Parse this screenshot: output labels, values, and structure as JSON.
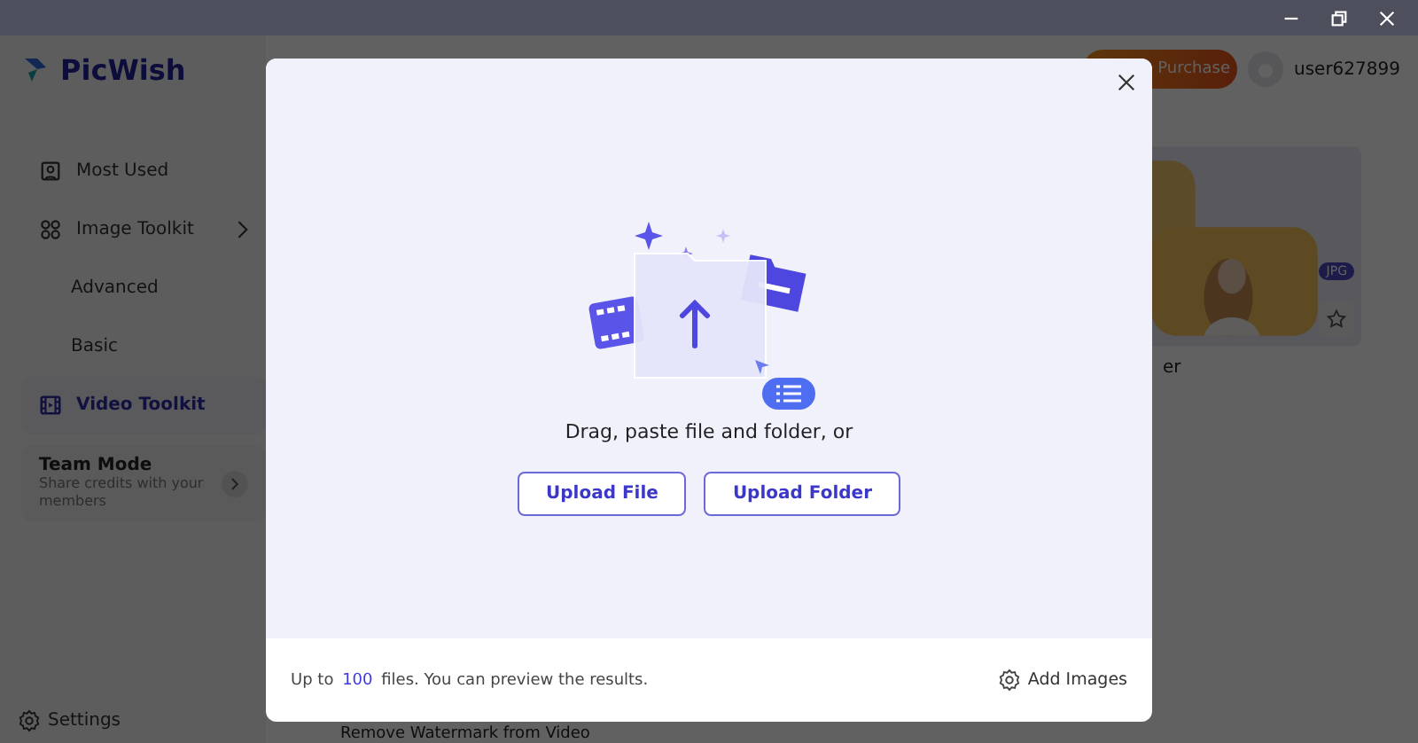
{
  "app": {
    "logo": "PicWish",
    "purchase": "Purchase",
    "user": "user627899"
  },
  "sidebar": {
    "items": [
      {
        "label": "Most Used",
        "selected": false
      },
      {
        "label": "Image Toolkit",
        "selected": false,
        "expandable": true
      },
      {
        "label": "Advanced",
        "selected": false
      },
      {
        "label": "Basic",
        "selected": false
      },
      {
        "label": "Video Toolkit",
        "selected": true
      }
    ],
    "team": {
      "title": "Team Mode",
      "subtitle": "Share credits with your members"
    },
    "settings": "Settings"
  },
  "content": {
    "card_badge": "JPG",
    "card_caption": "er",
    "bottom_label": "Remove Watermark from Video"
  },
  "dialog": {
    "prompt": "Drag, paste file and folder, or",
    "buttons": [
      "Upload File",
      "Upload Folder"
    ],
    "footer": {
      "before": "Up to",
      "count": "100",
      "after": "files. You can preview the results.",
      "add": "Add Images"
    }
  }
}
